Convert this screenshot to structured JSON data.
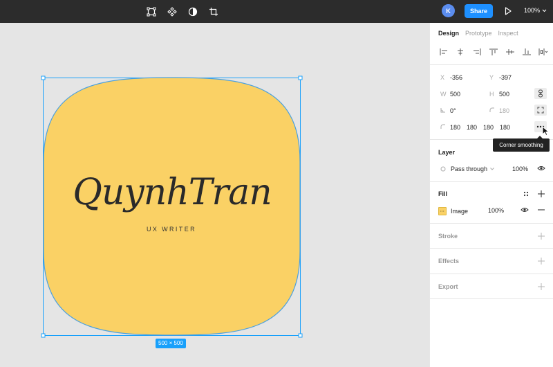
{
  "toolbar": {
    "avatar_initial": "K",
    "share_label": "Share",
    "zoom_value": "100%"
  },
  "canvas": {
    "logo_script_text": "QuynhTran",
    "logo_subtitle": "UX WRITER",
    "size_badge": "500 × 500",
    "shape_fill_color": "#fad165",
    "selection_color": "#18a0fb"
  },
  "panel": {
    "tabs": [
      {
        "label": "Design"
      },
      {
        "label": "Prototype"
      },
      {
        "label": "Inspect"
      }
    ],
    "transform": {
      "x_label": "X",
      "x_value": "-356",
      "y_label": "Y",
      "y_value": "-397",
      "w_label": "W",
      "w_value": "500",
      "h_label": "H",
      "h_value": "500",
      "rotation_value": "0°",
      "radius_value": "180",
      "corners": [
        "180",
        "180",
        "180",
        "180"
      ]
    },
    "tooltip": "Corner smoothing",
    "layer": {
      "title": "Layer",
      "blend_mode": "Pass through",
      "opacity": "100%"
    },
    "fill": {
      "title": "Fill",
      "type": "Image",
      "opacity": "100%"
    },
    "stroke_title": "Stroke",
    "effects_title": "Effects",
    "export_title": "Export"
  }
}
